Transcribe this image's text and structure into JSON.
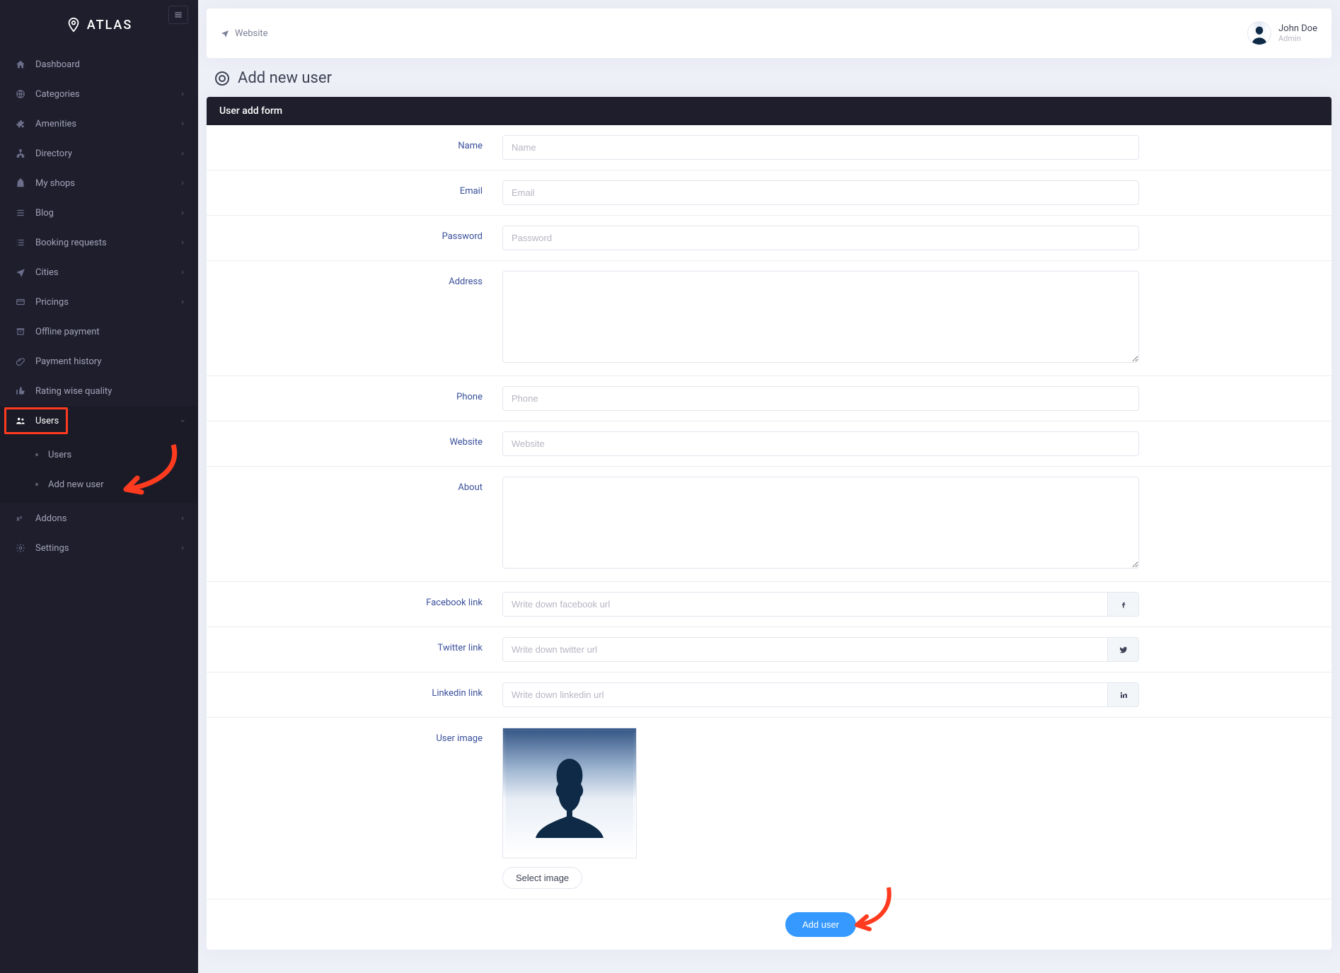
{
  "brand": "ATLAS",
  "topbar": {
    "website": "Website"
  },
  "user": {
    "name": "John Doe",
    "role": "Admin"
  },
  "page": {
    "title": "Add new user"
  },
  "card": {
    "header": "User add form"
  },
  "sidebar": [
    {
      "key": "dashboard",
      "label": "Dashboard",
      "chev": false
    },
    {
      "key": "categories",
      "label": "Categories",
      "chev": true
    },
    {
      "key": "amenities",
      "label": "Amenities",
      "chev": true
    },
    {
      "key": "directory",
      "label": "Directory",
      "chev": true
    },
    {
      "key": "myshops",
      "label": "My shops",
      "chev": true
    },
    {
      "key": "blog",
      "label": "Blog",
      "chev": true
    },
    {
      "key": "booking",
      "label": "Booking requests",
      "chev": true
    },
    {
      "key": "cities",
      "label": "Cities",
      "chev": true
    },
    {
      "key": "pricings",
      "label": "Pricings",
      "chev": true
    },
    {
      "key": "offline",
      "label": "Offline payment",
      "chev": false
    },
    {
      "key": "payhist",
      "label": "Payment history",
      "chev": false
    },
    {
      "key": "rating",
      "label": "Rating wise quality",
      "chev": false
    },
    {
      "key": "users",
      "label": "Users",
      "chev": true,
      "active": true,
      "highlighted": true,
      "sub": [
        {
          "key": "users-list",
          "label": "Users"
        },
        {
          "key": "add-user",
          "label": "Add new user",
          "arrow": true
        }
      ]
    },
    {
      "key": "addons",
      "label": "Addons",
      "chev": true
    },
    {
      "key": "settings",
      "label": "Settings",
      "chev": true
    }
  ],
  "form": {
    "name": {
      "label": "Name",
      "placeholder": "Name"
    },
    "email": {
      "label": "Email",
      "placeholder": "Email"
    },
    "password": {
      "label": "Password",
      "placeholder": "Password"
    },
    "address": {
      "label": "Address",
      "placeholder": ""
    },
    "phone": {
      "label": "Phone",
      "placeholder": "Phone"
    },
    "website": {
      "label": "Website",
      "placeholder": "Website"
    },
    "about": {
      "label": "About",
      "placeholder": ""
    },
    "facebook": {
      "label": "Facebook link",
      "placeholder": "Write down facebook url"
    },
    "twitter": {
      "label": "Twitter link",
      "placeholder": "Write down twitter url"
    },
    "linkedin": {
      "label": "Linkedin link",
      "placeholder": "Write down linkedin url"
    },
    "userimage": {
      "label": "User image",
      "select_btn": "Select image"
    }
  },
  "submit": {
    "label": "Add user"
  }
}
